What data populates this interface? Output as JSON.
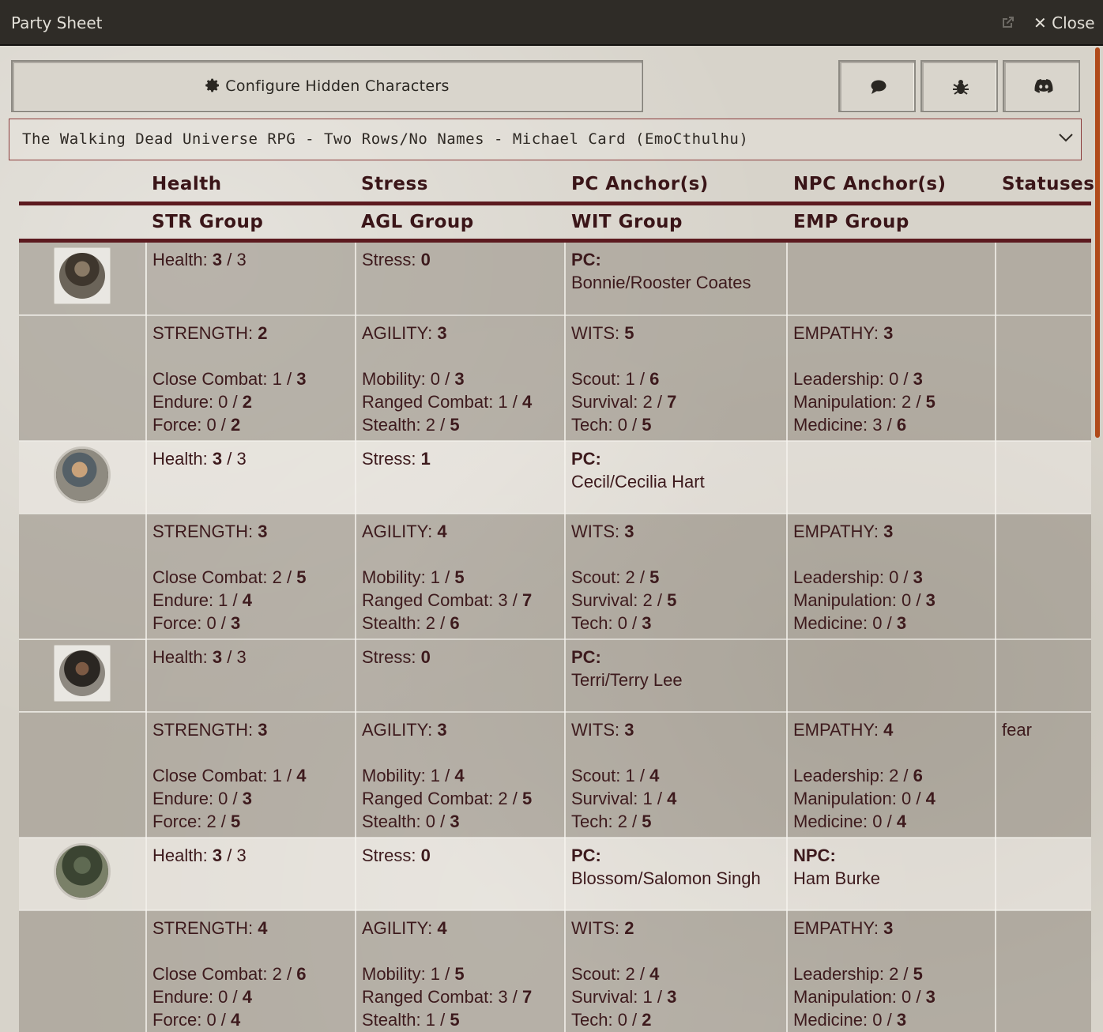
{
  "window": {
    "title": "Party Sheet",
    "close_label": "✕ Close"
  },
  "toolbar": {
    "configure_label": "Configure Hidden Characters",
    "icons": [
      "chat-icon",
      "bug-icon",
      "discord-icon"
    ]
  },
  "template_select": {
    "value": "The Walking Dead Universe RPG - Two Rows/No Names - Michael Card (EmoCthulhu)"
  },
  "headers": {
    "row1": [
      "Health",
      "Stress",
      "PC Anchor(s)",
      "NPC Anchor(s)",
      "Statuses"
    ],
    "row2": [
      "STR Group",
      "AGL Group",
      "WIT Group",
      "EMP Group"
    ]
  },
  "characters": [
    {
      "health_label": "Health:",
      "health": "3",
      "health_max": "/ 3",
      "stress_label": "Stress:",
      "stress": "0",
      "pc_label": "PC:",
      "pc_anchor": "Bonnie/Rooster Coates",
      "npc_label": "",
      "npc_anchor": "",
      "status": "",
      "str": {
        "label": "STRENGTH:",
        "value": "2",
        "skills": [
          {
            "name": "Close Combat: 1 /",
            "max": "3"
          },
          {
            "name": "Endure: 0 /",
            "max": "2"
          },
          {
            "name": "Force: 0 /",
            "max": "2"
          }
        ]
      },
      "agl": {
        "label": "AGILITY:",
        "value": "3",
        "skills": [
          {
            "name": "Mobility: 0 /",
            "max": "3"
          },
          {
            "name": "Ranged Combat: 1 /",
            "max": "4"
          },
          {
            "name": "Stealth: 2 /",
            "max": "5"
          }
        ]
      },
      "wit": {
        "label": "WITS:",
        "value": "5",
        "skills": [
          {
            "name": "Scout: 1 /",
            "max": "6"
          },
          {
            "name": "Survival: 2 /",
            "max": "7"
          },
          {
            "name": "Tech: 0 /",
            "max": "5"
          }
        ]
      },
      "emp": {
        "label": "EMPATHY:",
        "value": "3",
        "skills": [
          {
            "name": "Leadership: 0 /",
            "max": "3"
          },
          {
            "name": "Manipulation: 2 /",
            "max": "5"
          },
          {
            "name": "Medicine: 3 /",
            "max": "6"
          }
        ]
      }
    },
    {
      "health_label": "Health:",
      "health": "3",
      "health_max": "/ 3",
      "stress_label": "Stress:",
      "stress": "1",
      "pc_label": "PC:",
      "pc_anchor": "Cecil/Cecilia Hart",
      "npc_label": "",
      "npc_anchor": "",
      "status": "",
      "str": {
        "label": "STRENGTH:",
        "value": "3",
        "skills": [
          {
            "name": "Close Combat: 2 /",
            "max": "5"
          },
          {
            "name": "Endure: 1 /",
            "max": "4"
          },
          {
            "name": "Force: 0 /",
            "max": "3"
          }
        ]
      },
      "agl": {
        "label": "AGILITY:",
        "value": "4",
        "skills": [
          {
            "name": "Mobility: 1 /",
            "max": "5"
          },
          {
            "name": "Ranged Combat: 3 /",
            "max": "7"
          },
          {
            "name": "Stealth: 2 /",
            "max": "6"
          }
        ]
      },
      "wit": {
        "label": "WITS:",
        "value": "3",
        "skills": [
          {
            "name": "Scout: 2 /",
            "max": "5"
          },
          {
            "name": "Survival: 2 /",
            "max": "5"
          },
          {
            "name": "Tech: 0 /",
            "max": "3"
          }
        ]
      },
      "emp": {
        "label": "EMPATHY:",
        "value": "3",
        "skills": [
          {
            "name": "Leadership: 0 /",
            "max": "3"
          },
          {
            "name": "Manipulation: 0 /",
            "max": "3"
          },
          {
            "name": "Medicine: 0 /",
            "max": "3"
          }
        ]
      }
    },
    {
      "health_label": "Health:",
      "health": "3",
      "health_max": "/ 3",
      "stress_label": "Stress:",
      "stress": "0",
      "pc_label": "PC:",
      "pc_anchor": "Terri/Terry Lee",
      "npc_label": "",
      "npc_anchor": "",
      "status": "fear",
      "str": {
        "label": "STRENGTH:",
        "value": "3",
        "skills": [
          {
            "name": "Close Combat: 1 /",
            "max": "4"
          },
          {
            "name": "Endure: 0 /",
            "max": "3"
          },
          {
            "name": "Force: 2 /",
            "max": "5"
          }
        ]
      },
      "agl": {
        "label": "AGILITY:",
        "value": "3",
        "skills": [
          {
            "name": "Mobility: 1 /",
            "max": "4"
          },
          {
            "name": "Ranged Combat: 2 /",
            "max": "5"
          },
          {
            "name": "Stealth: 0 /",
            "max": "3"
          }
        ]
      },
      "wit": {
        "label": "WITS:",
        "value": "3",
        "skills": [
          {
            "name": "Scout: 1 /",
            "max": "4"
          },
          {
            "name": "Survival: 1 /",
            "max": "4"
          },
          {
            "name": "Tech: 2 /",
            "max": "5"
          }
        ]
      },
      "emp": {
        "label": "EMPATHY:",
        "value": "4",
        "skills": [
          {
            "name": "Leadership: 2 /",
            "max": "6"
          },
          {
            "name": "Manipulation: 0 /",
            "max": "4"
          },
          {
            "name": "Medicine: 0 /",
            "max": "4"
          }
        ]
      }
    },
    {
      "health_label": "Health:",
      "health": "3",
      "health_max": "/ 3",
      "stress_label": "Stress:",
      "stress": "0",
      "pc_label": "PC:",
      "pc_anchor": "Blossom/Salomon Singh",
      "npc_label": "NPC:",
      "npc_anchor": "Ham Burke",
      "status": "",
      "str": {
        "label": "STRENGTH:",
        "value": "4",
        "skills": [
          {
            "name": "Close Combat: 2 /",
            "max": "6"
          },
          {
            "name": "Endure: 0 /",
            "max": "4"
          },
          {
            "name": "Force: 0 /",
            "max": "4"
          }
        ]
      },
      "agl": {
        "label": "AGILITY:",
        "value": "4",
        "skills": [
          {
            "name": "Mobility: 1 /",
            "max": "5"
          },
          {
            "name": "Ranged Combat: 3 /",
            "max": "7"
          },
          {
            "name": "Stealth: 1 /",
            "max": "5"
          }
        ]
      },
      "wit": {
        "label": "WITS:",
        "value": "2",
        "skills": [
          {
            "name": "Scout: 2 /",
            "max": "4"
          },
          {
            "name": "Survival: 1 /",
            "max": "3"
          },
          {
            "name": "Tech: 0 /",
            "max": "2"
          }
        ]
      },
      "emp": {
        "label": "EMPATHY:",
        "value": "3",
        "skills": [
          {
            "name": "Leadership: 2 /",
            "max": "5"
          },
          {
            "name": "Manipulation: 0 /",
            "max": "3"
          },
          {
            "name": "Medicine: 0 /",
            "max": "3"
          }
        ]
      }
    }
  ],
  "colors": {
    "accent": "#5c1a1f",
    "text": "#3d1a1d",
    "titlebar": "#2f2c27",
    "scroll": "#b04a1a"
  }
}
